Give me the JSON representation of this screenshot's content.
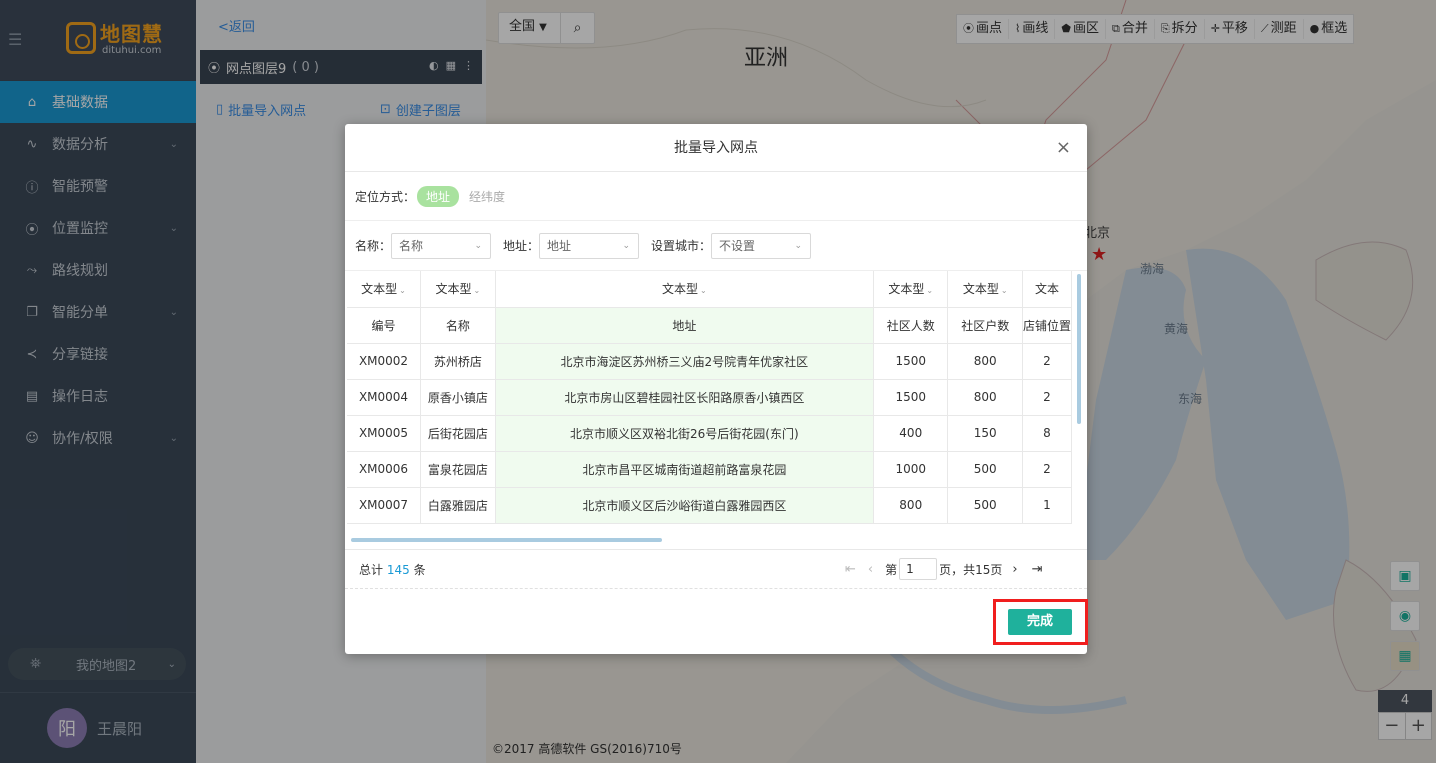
{
  "sidebar": {
    "logo_name": "地图慧",
    "logo_sub": "dituhui.com",
    "items": [
      {
        "label": "基础数据",
        "active": true,
        "icon": "home-icon",
        "chevron": false
      },
      {
        "label": "数据分析",
        "active": false,
        "icon": "chart-line-icon",
        "chevron": true
      },
      {
        "label": "智能预警",
        "active": false,
        "icon": "alert-icon",
        "chevron": false
      },
      {
        "label": "位置监控",
        "active": false,
        "icon": "location-pin-icon",
        "chevron": true
      },
      {
        "label": "路线规划",
        "active": false,
        "icon": "route-icon",
        "chevron": false
      },
      {
        "label": "智能分单",
        "active": false,
        "icon": "copy-icon",
        "chevron": true
      },
      {
        "label": "分享链接",
        "active": false,
        "icon": "share-icon",
        "chevron": false
      },
      {
        "label": "操作日志",
        "active": false,
        "icon": "calendar-icon",
        "chevron": false
      },
      {
        "label": "协作/权限",
        "active": false,
        "icon": "user-icon",
        "chevron": true
      }
    ],
    "my_map": "我的地图2",
    "user": {
      "avatar": "阳",
      "name": "王晨阳"
    }
  },
  "panel": {
    "back": "<返回",
    "layer_name": "网点图层9",
    "layer_count": "( 0 )",
    "import_link": "批量导入网点",
    "create_sub": "创建子图层"
  },
  "map": {
    "region": "全国",
    "toolbar": [
      {
        "icon": "pin-icon",
        "label": "画点"
      },
      {
        "icon": "polyline-icon",
        "label": "画线"
      },
      {
        "icon": "polygon-icon",
        "label": "画区"
      },
      {
        "icon": "merge-icon",
        "label": "合并"
      },
      {
        "icon": "split-icon",
        "label": "拆分"
      },
      {
        "icon": "move-icon",
        "label": "平移"
      },
      {
        "icon": "ruler-icon",
        "label": "测距"
      },
      {
        "icon": "lasso-icon",
        "label": "框选"
      }
    ],
    "labels": {
      "asia": "亚洲",
      "beijing": "北京",
      "bohai": "渤海",
      "huanghai": "黄海",
      "donghai": "东海"
    },
    "zoom_level": "4",
    "zoom_out": "−",
    "zoom_in": "+",
    "copyright": "©2017 高德软件 GS(2016)710号"
  },
  "modal": {
    "title": "批量导入网点",
    "locate_label": "定位方式：",
    "locate_active": "地址",
    "locate_inactive": "经纬度",
    "fields": [
      {
        "label": "名称：",
        "value": "名称"
      },
      {
        "label": "地址：",
        "value": "地址"
      },
      {
        "label": "设置城市：",
        "value": "不设置"
      }
    ],
    "table": {
      "type_row": [
        "文本型",
        "文本型",
        "文本型",
        "文本型",
        "文本型",
        "文本"
      ],
      "header": [
        "编号",
        "名称",
        "地址",
        "社区人数",
        "社区户数",
        "店铺位置"
      ],
      "rows": [
        [
          "XM0002",
          "苏州桥店",
          "北京市海淀区苏州桥三义庙2号院青年优家社区",
          "1500",
          "800",
          "2"
        ],
        [
          "XM0004",
          "原香小镇店",
          "北京市房山区碧桂园社区长阳路原香小镇西区",
          "1500",
          "800",
          "2"
        ],
        [
          "XM0005",
          "后街花园店",
          "北京市顺义区双裕北街26号后街花园(东门)",
          "400",
          "150",
          "8"
        ],
        [
          "XM0006",
          "富泉花园店",
          "北京市昌平区城南街道超前路富泉花园",
          "1000",
          "500",
          "2"
        ],
        [
          "XM0007",
          "白露雅园店",
          "北京市顺义区后沙峪街道白露雅园西区",
          "800",
          "500",
          "1"
        ]
      ]
    },
    "total_prefix": "总计",
    "total_count": "145",
    "total_suffix": "条",
    "page_prefix": "第",
    "page_value": "1",
    "page_suffix": "页，共15页",
    "finish": "完成"
  }
}
